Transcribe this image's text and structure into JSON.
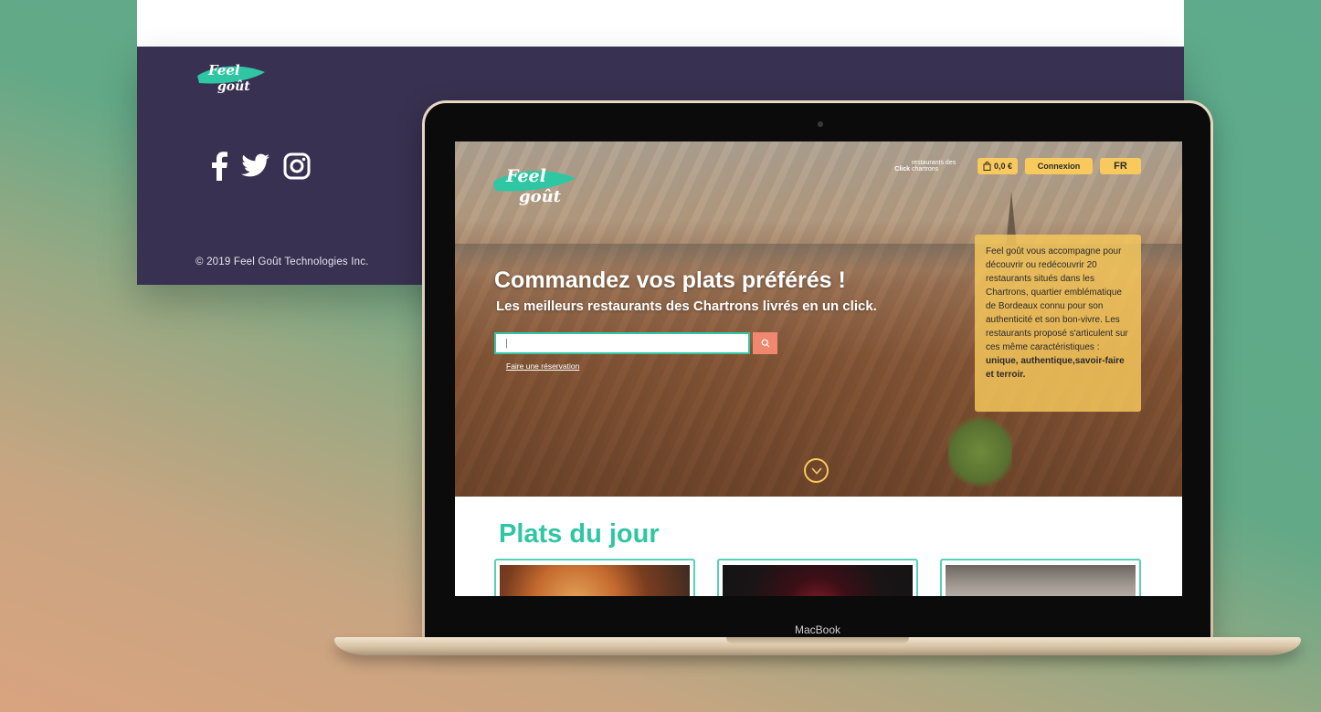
{
  "footer": {
    "logo_text_1": "Feel",
    "logo_text_2": "goût",
    "social_icons": [
      "facebook-icon",
      "twitter-icon",
      "instagram-icon"
    ],
    "copyright": "© 2019 Feel Goût Technologies Inc."
  },
  "laptop": {
    "brand": "MacBook"
  },
  "site": {
    "logo_text_1": "Feel",
    "logo_text_2": "goût",
    "nav": {
      "click_bold": "Click",
      "click_text": "restaurants des chartrons",
      "cart_value": "0,0 €",
      "connexion": "Connexion",
      "language": "FR"
    },
    "hero": {
      "title": "Commandez vos plats préférés !",
      "subtitle": "Les meilleurs restaurants des Chartrons livrés en un click.",
      "search_value": "|",
      "reservation_link": "Faire une réservation"
    },
    "info_card": {
      "text": "Feel goût vous accompagne pour découvrir ou redécouvrir 20 restaurants situés dans les Chartrons, quartier emblématique de Bordeaux connu pour son authenticité et son bon-vivre. Les restaurants proposé s'articulent sur ces même caractéristiques :",
      "highlight": "unique, authentique,savoir-faire et terroir."
    },
    "section_title": "Plats du jour"
  },
  "colors": {
    "footer_bg": "#383151",
    "accent_teal": "#2fc6a3",
    "button_yellow": "#f8c95c",
    "search_orange": "#f0876f"
  }
}
